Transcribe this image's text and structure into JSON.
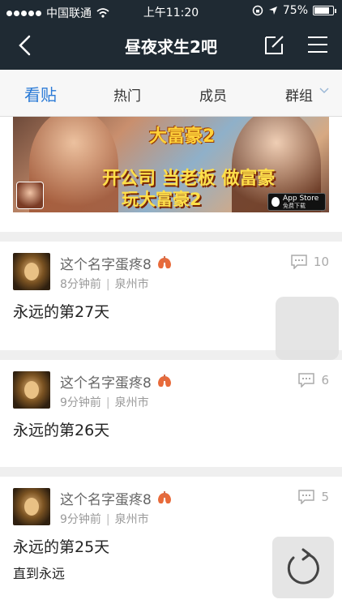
{
  "status_bar": {
    "carrier": "中国联通",
    "time": "上午11:20",
    "battery": "75%"
  },
  "nav": {
    "title": "昼夜求生2吧"
  },
  "tabs": [
    {
      "label": "看贴",
      "active": true
    },
    {
      "label": "热门"
    },
    {
      "label": "成员"
    },
    {
      "label": "群组"
    }
  ],
  "banner": {
    "logo": "大富豪2",
    "slogan_line1": "开公司 当老板 做富豪",
    "slogan_line2": "玩大富豪2",
    "badge_line1": "App Store",
    "badge_line2": "免费下载"
  },
  "posts": [
    {
      "author": "这个名字蛋疼8",
      "time": "8分钟前",
      "location": "泉州市",
      "comments": "10",
      "title": "永远的第27天",
      "body": ""
    },
    {
      "author": "这个名字蛋疼8",
      "time": "9分钟前",
      "location": "泉州市",
      "comments": "6",
      "title": "永远的第26天",
      "body": ""
    },
    {
      "author": "这个名字蛋疼8",
      "time": "9分钟前",
      "location": "泉州市",
      "comments": "5",
      "title": "永远的第25天",
      "body": "直到永远"
    }
  ],
  "colors": {
    "nav_bg": "#1f2a33",
    "accent": "#2a7ad6"
  }
}
